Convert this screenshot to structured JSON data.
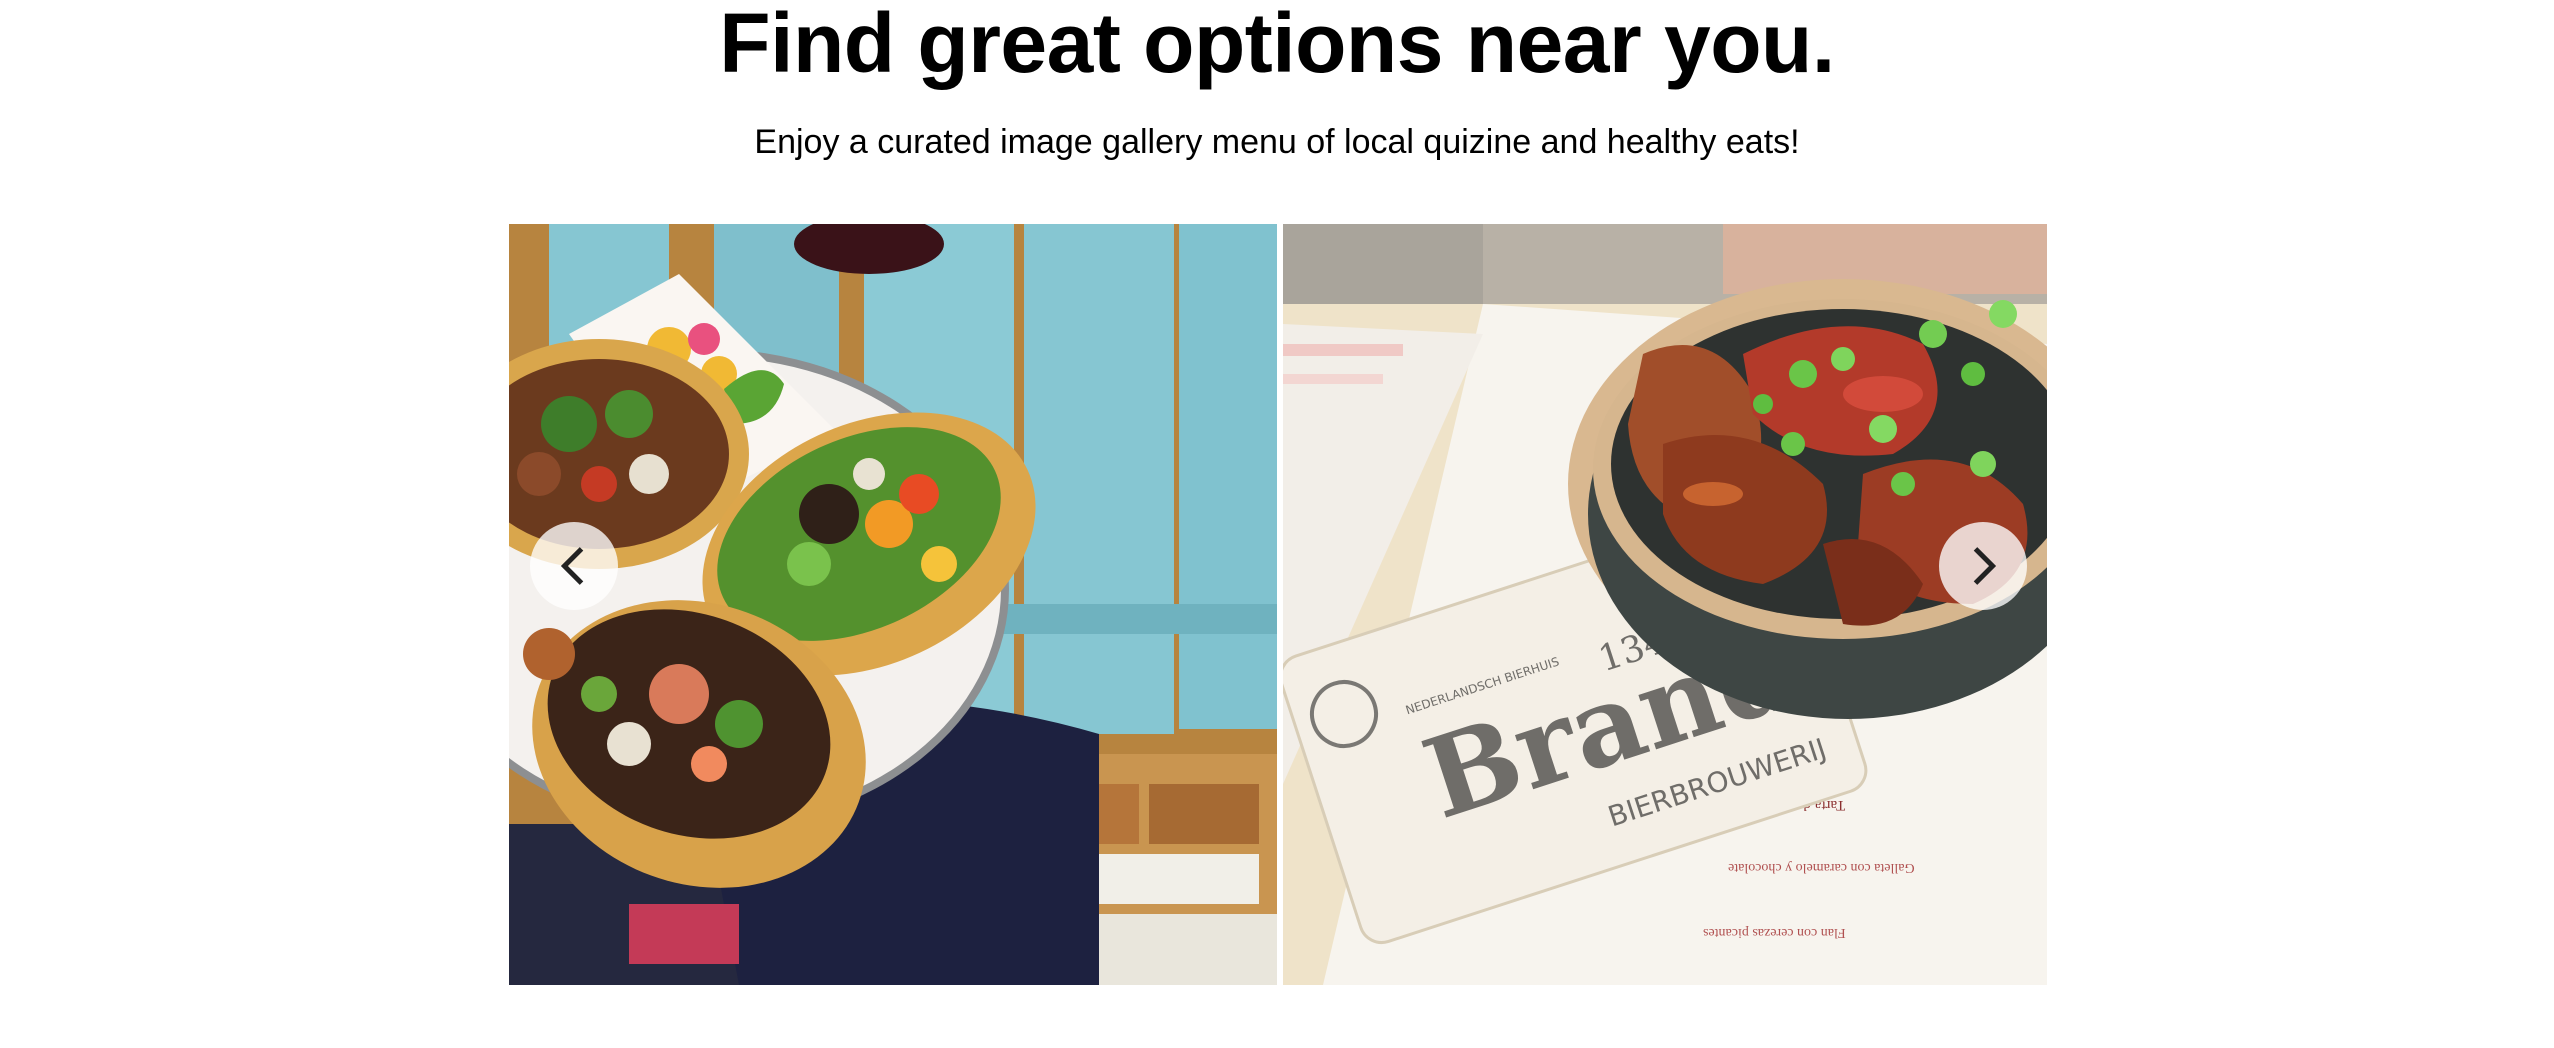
{
  "hero": {
    "title": "Find great options near you.",
    "subtitle": "Enjoy a curated image gallery menu of local quizine and healthy eats!"
  },
  "gallery": {
    "slides": [
      {
        "subject": "tacos on plate over blue table"
      },
      {
        "subject": "glazed chicken bowl with coaster and menu"
      }
    ],
    "coaster": {
      "brand": "Brand",
      "year": "1340",
      "tag": "BIERBROUWERIJ",
      "small": "NEDERLANDSCH BIERHUIS"
    },
    "menu_lines": [
      "Tarta de limón",
      "Galleta con caramelo y chocolate",
      "Flan con cerezas picantes"
    ],
    "prev_icon": "chevron-left-icon",
    "next_icon": "chevron-right-icon"
  },
  "colors": {
    "accent_table": "#86c6d2",
    "text": "#000000",
    "button_bg": "#ffffff"
  }
}
